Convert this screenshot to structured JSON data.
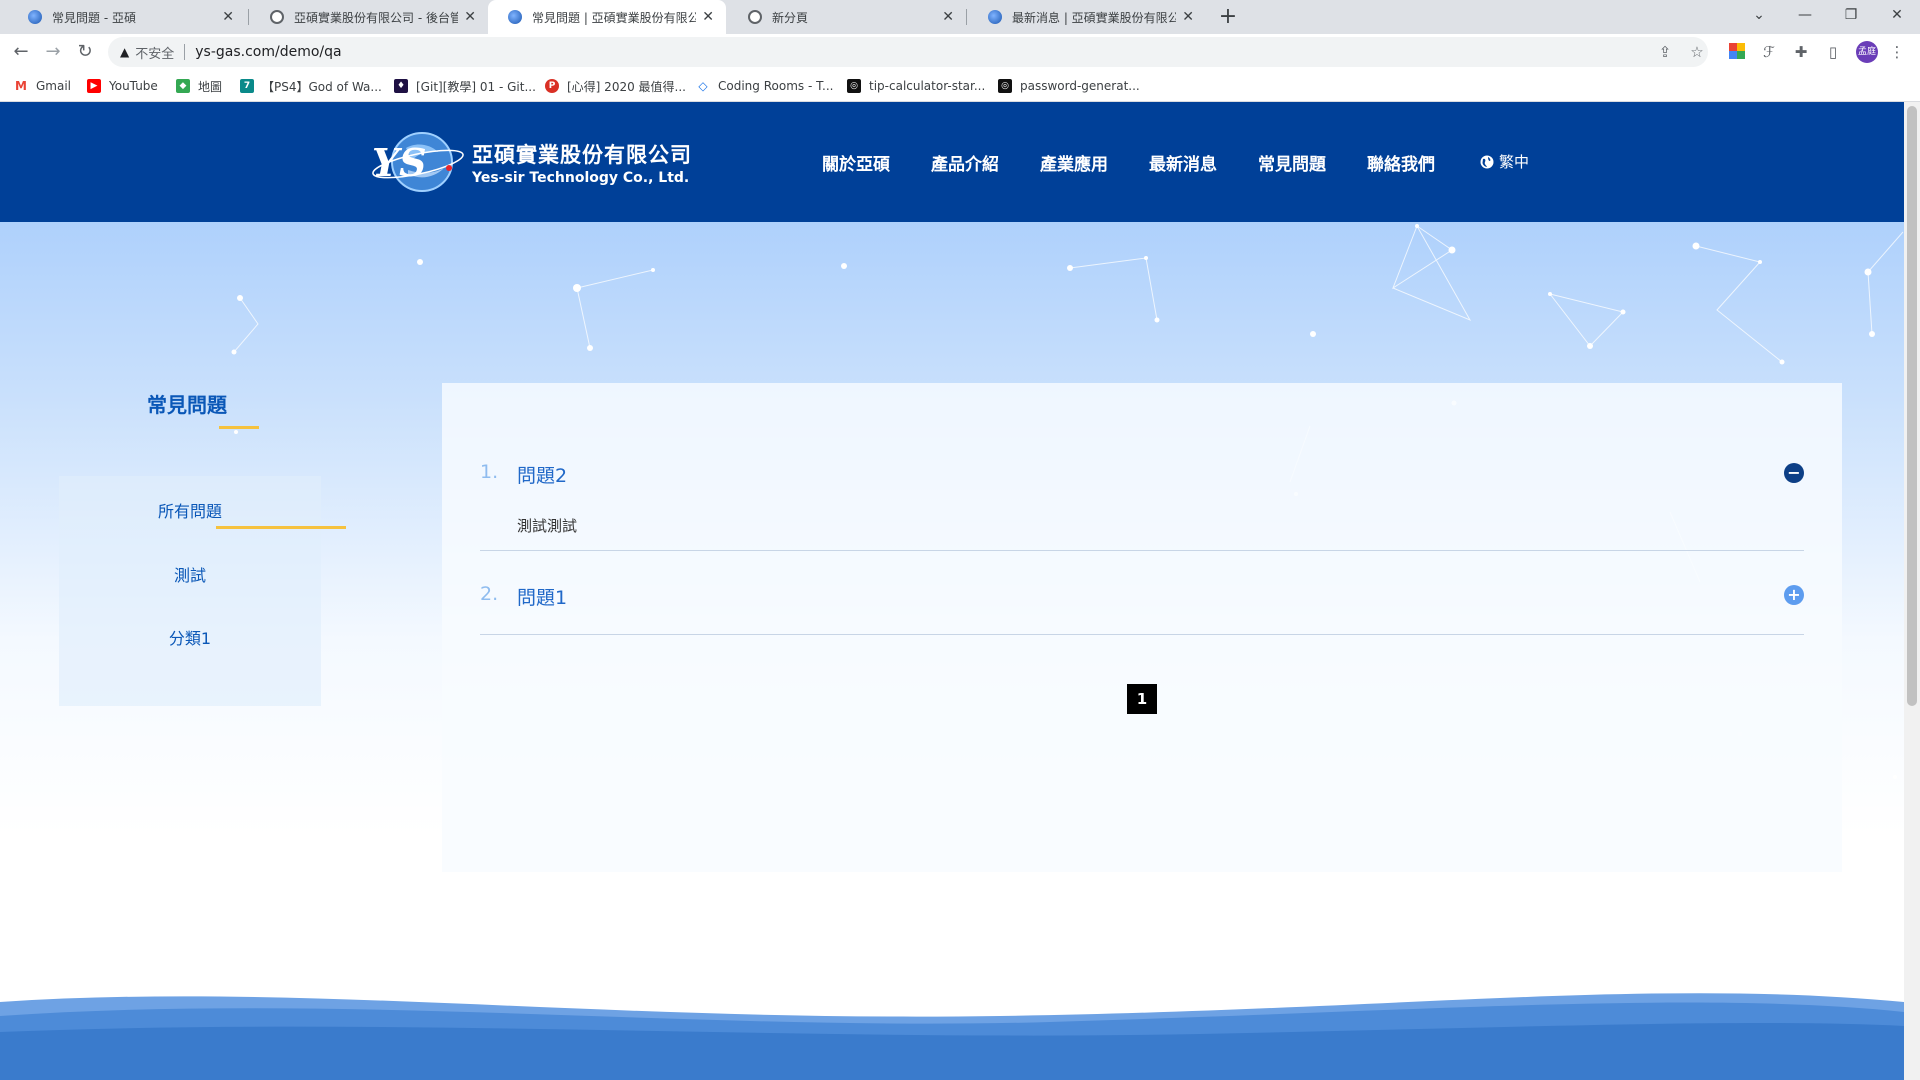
{
  "browser": {
    "tabs": [
      {
        "title": "常見問題 - 亞碩",
        "active": false
      },
      {
        "title": "亞碩實業股份有限公司 - 後台管理",
        "active": false
      },
      {
        "title": "常見問題 | 亞碩實業股份有限公司",
        "active": true
      },
      {
        "title": "新分頁",
        "active": false
      },
      {
        "title": "最新消息 | 亞碩實業股份有限公司",
        "active": false
      }
    ],
    "security_label": "不安全",
    "url": "ys-gas.com/demo/qa",
    "profile_initials": "孟庭",
    "bookmarks": [
      "Gmail",
      "YouTube",
      "地圖",
      "【PS4】God of Wa...",
      "[Git][教學] 01 - Git...",
      "[心得] 2020 最值得...",
      "Coding Rooms - T...",
      "tip-calculator-star...",
      "password-generat..."
    ]
  },
  "site": {
    "logo_zh": "亞碩實業股份有限公司",
    "logo_en": "Yes-sir Technology Co., Ltd.",
    "logo_mark": "YS",
    "nav": [
      "關於亞碩",
      "產品介紹",
      "產業應用",
      "最新消息",
      "常見問題",
      "聯絡我們"
    ],
    "language": "繁中"
  },
  "sidebar": {
    "title": "常見問題",
    "categories": [
      "所有問題",
      "測試",
      "分類1"
    ],
    "active_category": "所有問題"
  },
  "faq": {
    "items": [
      {
        "num": "1.",
        "question": "問題2",
        "answer": "測試測試",
        "expanded": true
      },
      {
        "num": "2.",
        "question": "問題1",
        "answer": "",
        "expanded": false
      }
    ],
    "current_page": "1"
  },
  "colors": {
    "header_bg": "#004098",
    "accent_yellow": "#f6c23e",
    "link_blue": "#0a57b7",
    "expanded_btn": "#0d3f86",
    "collapsed_btn": "#5d9cef"
  }
}
